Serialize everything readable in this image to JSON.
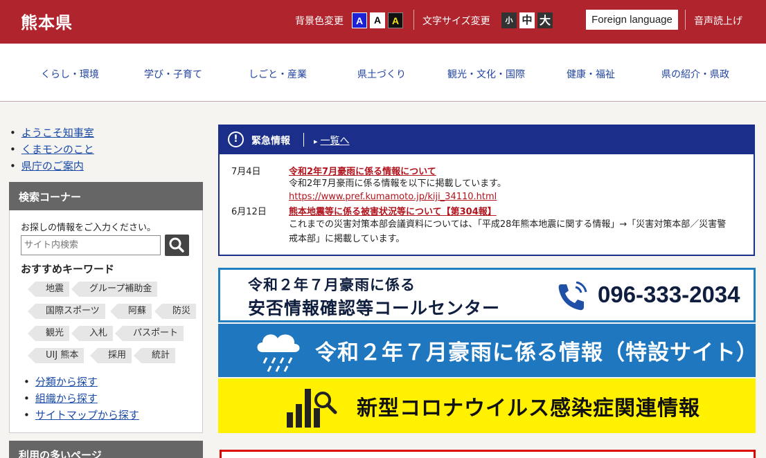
{
  "header": {
    "logo": "熊本県",
    "bg_color_label": "背景色変更",
    "bg_options": [
      "A",
      "A",
      "A"
    ],
    "font_size_label": "文字サイズ変更",
    "font_sizes": [
      "小",
      "中",
      "大"
    ],
    "foreign_language": "Foreign language",
    "voice_reading": "音声読上げ"
  },
  "nav": {
    "items": [
      "くらし・環境",
      "学び・子育て",
      "しごと・産業",
      "県土づくり",
      "観光・文化・国際",
      "健康・福祉",
      "県の紹介・県政"
    ]
  },
  "sidebar": {
    "quick_links": [
      "ようこそ知事室",
      "くまモンのこと",
      "県庁のご案内"
    ],
    "search": {
      "title": "検索コーナー",
      "prompt": "お探しの情報をご入力ください。",
      "placeholder": "サイト内検索",
      "keywords_title": "おすすめキーワード",
      "keywords": [
        "地震",
        "グループ補助金",
        "国際スポーツ",
        "阿蘇",
        "防災",
        "観光",
        "入札",
        "パスポート",
        "UIJ 熊本",
        "採用",
        "統計"
      ],
      "links": [
        "分類から探す",
        "組織から探す",
        "サイトマップから探す"
      ]
    },
    "popular_title": "利用の多いページ"
  },
  "emergency": {
    "title": "緊急情報",
    "list_link": "一覧へ",
    "items": [
      {
        "date": "7月4日",
        "link": "令和2年7月豪雨に係る情報について",
        "text": "令和2年7月豪雨に係る情報を以下に掲載しています。",
        "url": "https://www.pref.kumamoto.jp/kiji_34110.html"
      },
      {
        "date": "6月12日",
        "link": "熊本地震等に係る被害状況等について【第304報】",
        "text": "これまでの災害対策本部会議資料については、「平成28年熊本地震に関する情報」→「災害対策本部／災害警戒本部」に掲載しています。"
      }
    ]
  },
  "banners": {
    "call_center_line1": "令和２年７月豪雨に係る",
    "call_center_line2": "安否情報確認等コールセンター",
    "call_center_phone": "096-333-2034",
    "special_site": "令和２年７月豪雨に係る情報（特設サイト）",
    "corona": "新型コロナウイルス感染症関連情報"
  }
}
